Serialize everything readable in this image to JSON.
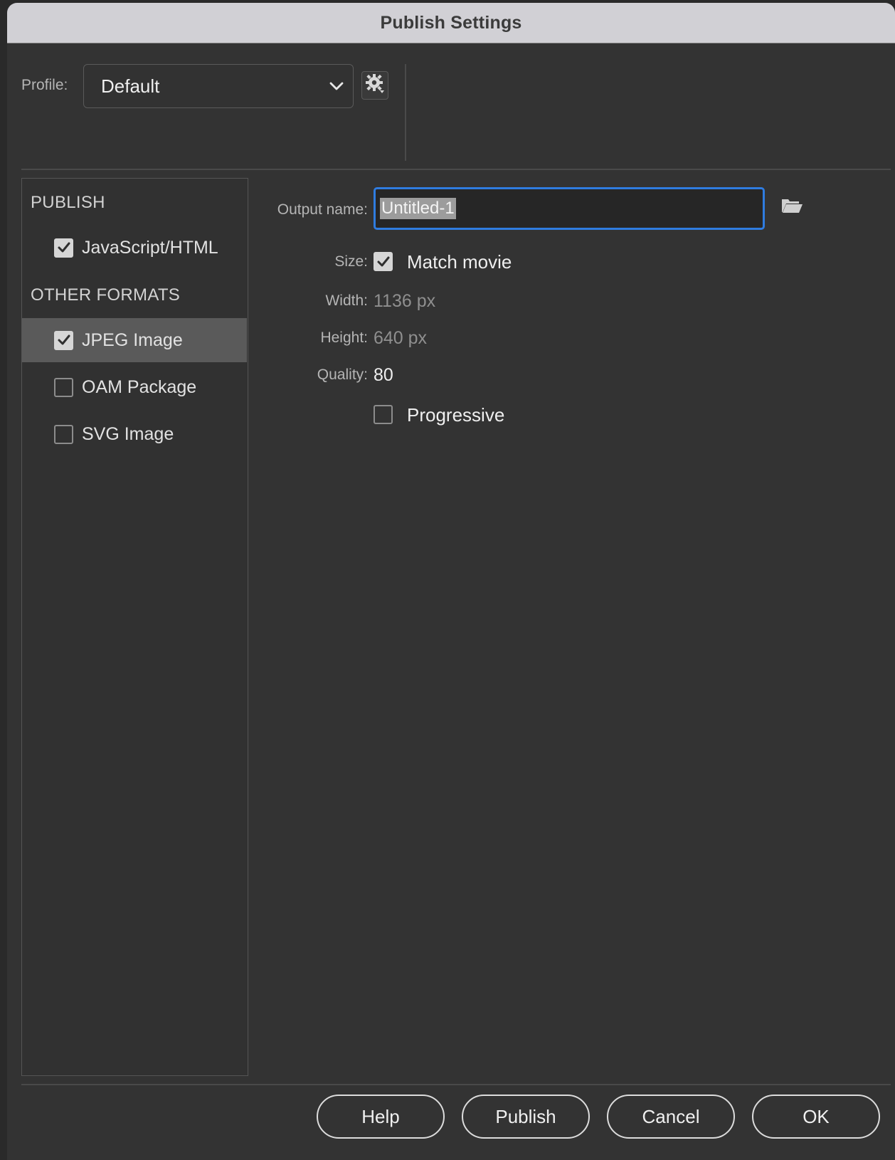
{
  "window": {
    "title": "Publish Settings"
  },
  "profile": {
    "label": "Profile:",
    "value": "Default"
  },
  "sidebar": {
    "publish_header": "PUBLISH",
    "publish_items": [
      {
        "label": "JavaScript/HTML",
        "checked": true
      }
    ],
    "other_header": "OTHER FORMATS",
    "other_items": [
      {
        "label": "JPEG Image",
        "checked": true,
        "selected": true
      },
      {
        "label": "OAM Package",
        "checked": false
      },
      {
        "label": "SVG Image",
        "checked": false
      }
    ]
  },
  "settings": {
    "output_label": "Output name:",
    "output_value": "Untitled-1",
    "size_label": "Size:",
    "match_movie_label": "Match movie",
    "match_movie_checked": true,
    "width_label": "Width:",
    "width_value": "1136 px",
    "height_label": "Height:",
    "height_value": "640 px",
    "quality_label": "Quality:",
    "quality_value": "80",
    "progressive_label": "Progressive",
    "progressive_checked": false
  },
  "buttons": {
    "help": "Help",
    "publish": "Publish",
    "cancel": "Cancel",
    "ok": "OK"
  },
  "colors": {
    "focus_ring": "#2f7ce0",
    "selected_row": "#5a5a5a",
    "panel_bg": "#333333"
  }
}
